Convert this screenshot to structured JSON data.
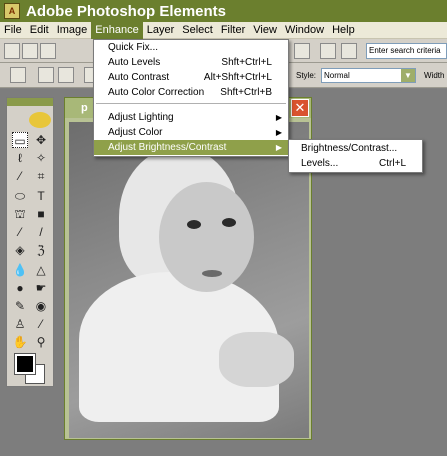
{
  "app": {
    "title": "Adobe Photoshop Elements",
    "logo_text": "A"
  },
  "menubar": {
    "items": [
      {
        "label": "File"
      },
      {
        "label": "Edit"
      },
      {
        "label": "Image"
      },
      {
        "label": "Enhance"
      },
      {
        "label": "Layer"
      },
      {
        "label": "Select"
      },
      {
        "label": "Filter"
      },
      {
        "label": "View"
      },
      {
        "label": "Window"
      },
      {
        "label": "Help"
      }
    ],
    "active": "Enhance"
  },
  "toolbar": {
    "search_placeholder": "Enter search criteria",
    "style_label": "Style:",
    "style_value": "Normal",
    "width_label": "Width"
  },
  "document": {
    "title": "p",
    "close_icon": "close-icon"
  },
  "enhance_menu": {
    "items": [
      {
        "label": "Quick Fix...",
        "shortcut": ""
      },
      {
        "label": "Auto Levels",
        "shortcut": "Shft+Ctrl+L"
      },
      {
        "label": "Auto Contrast",
        "shortcut": "Alt+Shft+Ctrl+L"
      },
      {
        "label": "Auto Color Correction",
        "shortcut": "Shft+Ctrl+B"
      },
      {
        "label": "Adjust Lighting",
        "submenu": true
      },
      {
        "label": "Adjust Color",
        "submenu": true
      },
      {
        "label": "Adjust Brightness/Contrast",
        "submenu": true,
        "highlighted": true
      }
    ]
  },
  "brightness_submenu": {
    "items": [
      {
        "label": "Brightness/Contrast...",
        "shortcut": ""
      },
      {
        "label": "Levels...",
        "shortcut": "Ctrl+L"
      }
    ]
  },
  "colors": {
    "accent": "#8fa04a",
    "titlebar": "#6b7f2e",
    "close": "#d9532e"
  }
}
